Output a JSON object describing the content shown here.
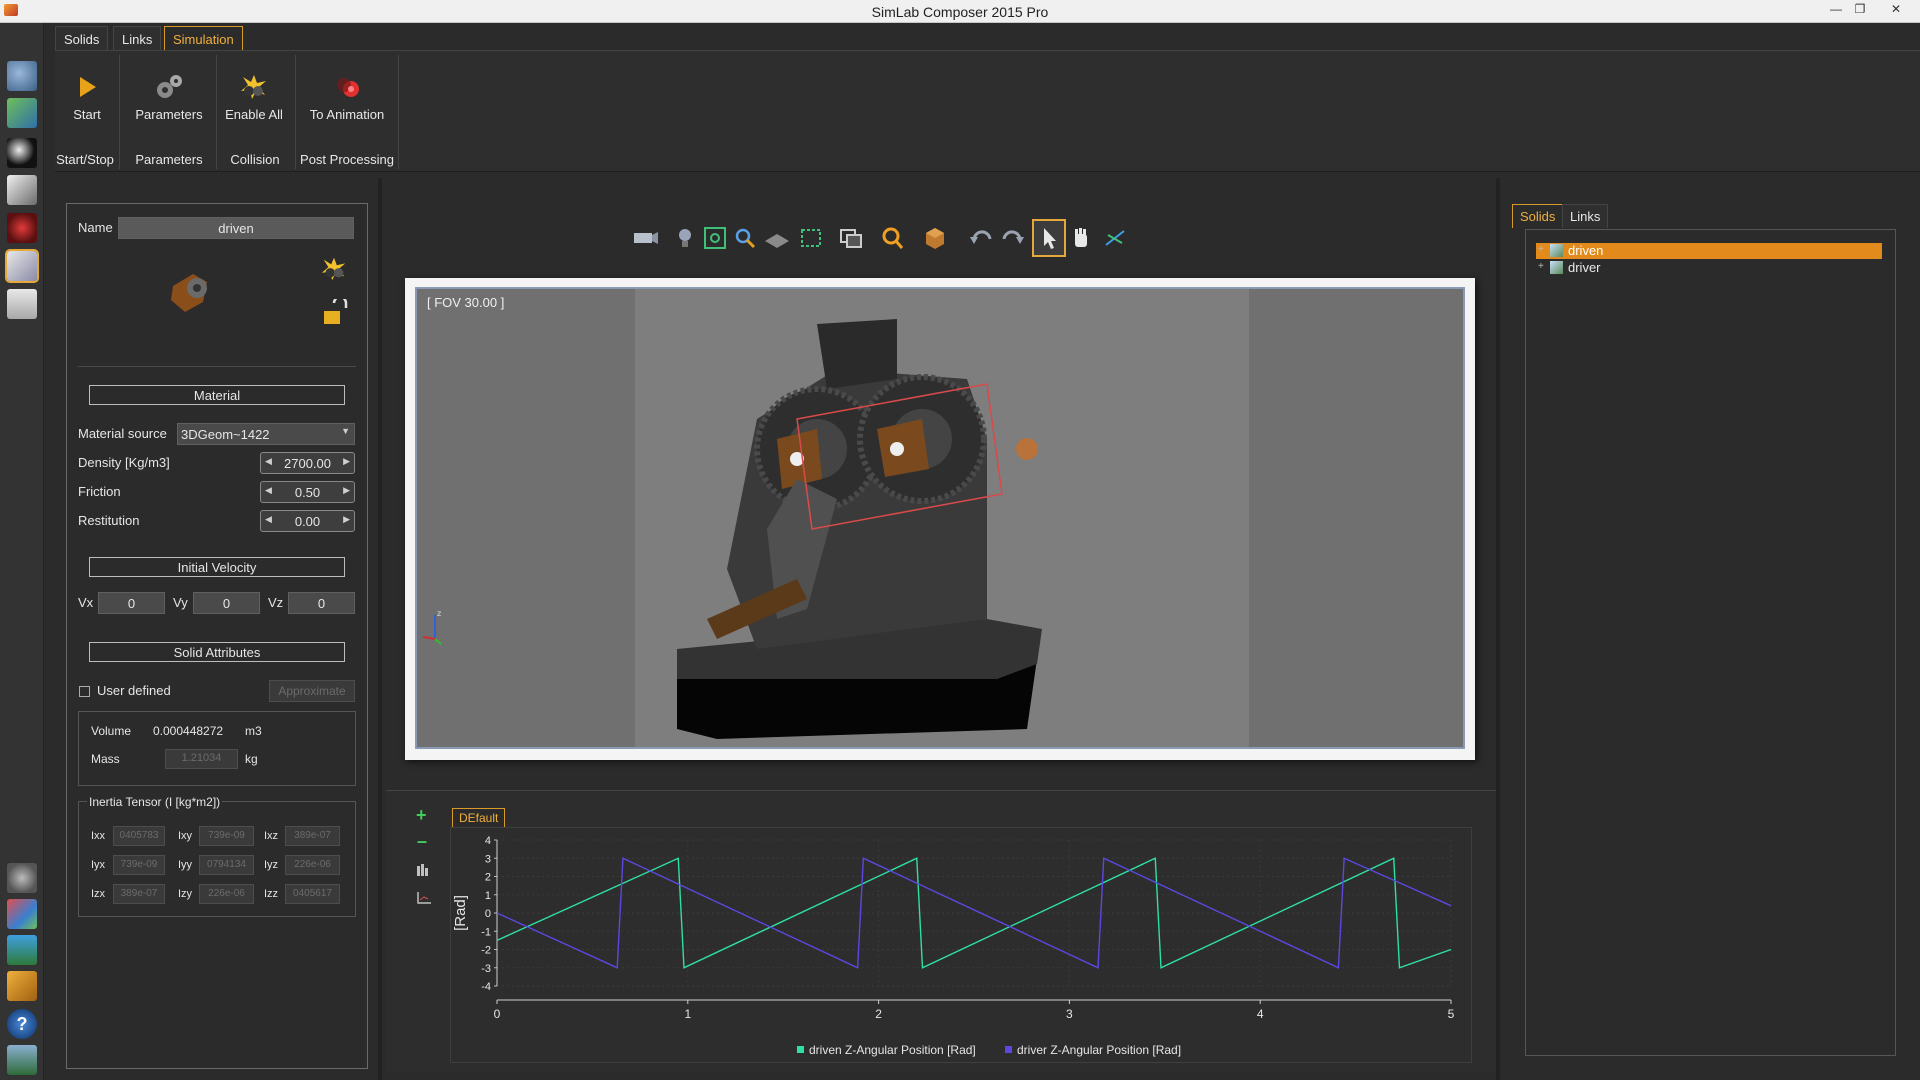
{
  "window": {
    "title": "SimLab Composer 2015 Pro"
  },
  "ribbon": {
    "tabs": [
      "Solids",
      "Links",
      "Simulation"
    ],
    "buttons": {
      "start": "Start",
      "parameters": "Parameters",
      "enable_all": "Enable All",
      "to_animation": "To Animation"
    },
    "groups": {
      "start_stop": "Start/Stop",
      "parameters": "Parameters",
      "collision": "Collision",
      "post_processing": "Post Processing"
    }
  },
  "props": {
    "name_label": "Name",
    "name_value": "driven",
    "material_header": "Material",
    "material_source_label": "Material source",
    "material_source_value": "3DGeom~1422",
    "density_label": "Density [Kg/m3]",
    "density_value": "2700.00",
    "friction_label": "Friction",
    "friction_value": "0.50",
    "restitution_label": "Restitution",
    "restitution_value": "0.00",
    "initial_velocity_header": "Initial Velocity",
    "vx_label": "Vx",
    "vx_value": "0",
    "vy_label": "Vy",
    "vy_value": "0",
    "vz_label": "Vz",
    "vz_value": "0",
    "solid_attributes_header": "Solid Attributes",
    "user_defined_label": "User defined",
    "approximate_label": "Approximate",
    "volume_label": "Volume",
    "volume_value": "0.000448272",
    "volume_unit": "m3",
    "mass_label": "Mass",
    "mass_value": "1.21034",
    "mass_unit": "kg",
    "inertia_header": "Inertia Tensor (I [kg*m2])",
    "inertia": {
      "ixx_label": "Ixx",
      "ixx": "0405783",
      "ixy_label": "Ixy",
      "ixy": "739e-09",
      "ixz_label": "Ixz",
      "ixz": "389e-07",
      "iyx_label": "Iyx",
      "iyx": "739e-09",
      "iyy_label": "Iyy",
      "iyy": "0794134",
      "iyz_label": "Iyz",
      "iyz": "226e-06",
      "izx_label": "Izx",
      "izx": "389e-07",
      "izy_label": "Izy",
      "izy": "226e-06",
      "izz_label": "Izz",
      "izz": "0405617"
    }
  },
  "viewport": {
    "fov_label": "[ FOV 30.00 ]"
  },
  "graph": {
    "tab_label": "DEfault"
  },
  "chart_data": {
    "type": "line",
    "ylabel": "[Rad]",
    "xlim": [
      0,
      5
    ],
    "ylim": [
      -4,
      4
    ],
    "x_ticks": [
      "0",
      "1",
      "2",
      "3",
      "4",
      "5"
    ],
    "y_ticks": [
      "4",
      "3",
      "2",
      "1",
      "0",
      "-1",
      "-2",
      "-3",
      "-4"
    ],
    "grid": true,
    "legend_position": "bottom-center",
    "series": [
      {
        "name": "driven Z-Angular Position [Rad]",
        "color": "#2fe0a0",
        "x": [
          0,
          0.95,
          0.98,
          2.2,
          2.23,
          3.45,
          3.48,
          4.7,
          4.73,
          5.0
        ],
        "values": [
          -1.5,
          3.0,
          -3.0,
          3.0,
          -3.0,
          3.0,
          -3.0,
          3.0,
          -3.0,
          -2.0
        ]
      },
      {
        "name": "driver Z-Angular Position [Rad]",
        "color": "#5a48e0",
        "x": [
          0,
          0.63,
          0.66,
          1.89,
          1.92,
          3.15,
          3.18,
          4.41,
          4.44,
          5.0
        ],
        "values": [
          0.0,
          -3.0,
          3.0,
          -3.0,
          3.0,
          -3.0,
          3.0,
          -3.0,
          3.0,
          0.4
        ]
      }
    ]
  },
  "right_panel": {
    "tabs": [
      "Solids",
      "Links"
    ],
    "tree": [
      "driven",
      "driver"
    ]
  },
  "colors": {
    "accent": "#e5a83b",
    "selection": "#e38a1c"
  }
}
